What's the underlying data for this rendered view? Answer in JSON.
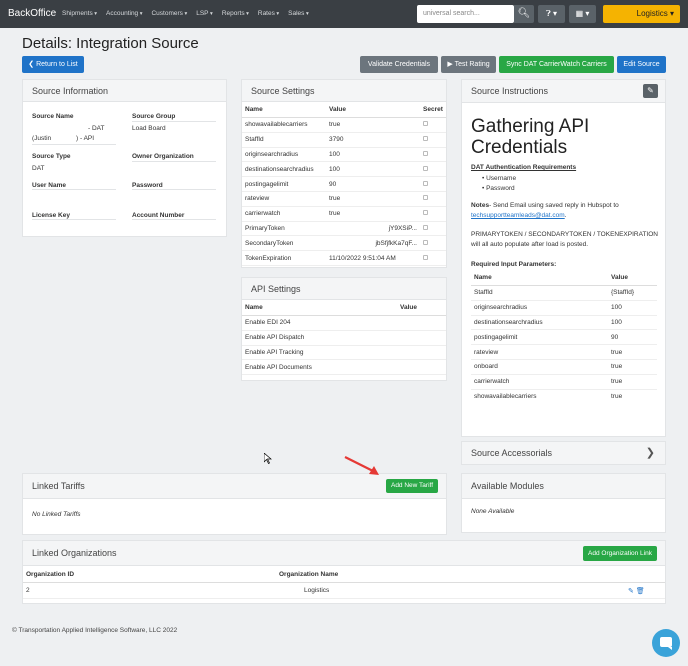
{
  "nav": {
    "brand": "BackOffice",
    "menu": [
      "Shipments",
      "Accounting",
      "Customers",
      "LSP",
      "Reports",
      "Rates",
      "Sales"
    ],
    "search_placeholder": "universal search...",
    "org": "Logistics"
  },
  "page": {
    "title": "Details: Integration Source",
    "return_label": "Return to List",
    "validate_label": "Validate Credentials",
    "test_label": "Test Rating",
    "sync_label": "Sync DAT CarrierWatch Carriers",
    "edit_label": "Edit Source"
  },
  "info": {
    "title": "Source Information",
    "source_name_label": "Source Name",
    "source_name_line1": "- DAT",
    "source_name_line2": "(Justin",
    "source_name_line3": ") - API",
    "source_group_label": "Source Group",
    "source_group": "Load Board",
    "source_type_label": "Source Type",
    "source_type": "DAT",
    "owner_label": "Owner Organization",
    "user_label": "User Name",
    "password_label": "Password",
    "license_label": "License Key",
    "account_label": "Account Number"
  },
  "settings": {
    "title": "Source Settings",
    "headers": [
      "Name",
      "Value",
      "Secret"
    ],
    "rows": [
      {
        "name": "showavailablecarriers",
        "value": "true"
      },
      {
        "name": "StaffId",
        "value": "3790"
      },
      {
        "name": "originsearchradius",
        "value": "100"
      },
      {
        "name": "destinationsearchradius",
        "value": "100"
      },
      {
        "name": "postingagelimit",
        "value": "90"
      },
      {
        "name": "rateview",
        "value": "true"
      },
      {
        "name": "carrierwatch",
        "value": "true"
      },
      {
        "name": "PrimaryToken",
        "value": "jY9XSiP..."
      },
      {
        "name": "SecondaryToken",
        "value": "jbSfjfkKa7qF..."
      },
      {
        "name": "TokenExpiration",
        "value": "11/10/2022 9:51:04 AM"
      }
    ]
  },
  "api": {
    "title": "API Settings",
    "headers": [
      "Name",
      "Value"
    ],
    "rows": [
      "Enable EDI 204",
      "Enable API Dispatch",
      "Enable API Tracking",
      "Enable API Documents"
    ]
  },
  "instructions": {
    "title": "Source Instructions",
    "heading": "Gathering API Credentials",
    "auth_title": "DAT Authentication Requirements",
    "bullets": [
      "Username",
      "Password"
    ],
    "notes_label": "Notes",
    "notes_text": "- Send Email using saved reply in Hubspot to",
    "email": "techsupportteamleads@dat.com",
    "email_suffix": ".",
    "tokens_text": "PRIMARYTOKEN / SECONDARYTOKEN / TOKENEXPIRATION will all auto populate after load is posted.",
    "req_title": "Required Input Parameters:",
    "headers": [
      "Name",
      "Value"
    ],
    "rows": [
      {
        "name": "StaffId",
        "value": "{StaffId}"
      },
      {
        "name": "originsearchradius",
        "value": "100"
      },
      {
        "name": "destinationsearchradius",
        "value": "100"
      },
      {
        "name": "postingagelimit",
        "value": "90"
      },
      {
        "name": "rateview",
        "value": "true"
      },
      {
        "name": "onboard",
        "value": "true"
      },
      {
        "name": "carrierwatch",
        "value": "true"
      },
      {
        "name": "showavailablecarriers",
        "value": "true"
      }
    ]
  },
  "accessorials": {
    "title": "Source Accessorials"
  },
  "modules": {
    "title": "Available Modules",
    "empty": "None Available"
  },
  "tariffs": {
    "title": "Linked Tariffs",
    "add_label": "Add New Tariff",
    "empty": "No Linked Tariffs"
  },
  "orgs": {
    "title": "Linked Organizations",
    "add_label": "Add Organization Link",
    "headers": [
      "Organization ID",
      "Organization Name"
    ],
    "rows": [
      {
        "id": "2",
        "name": "Logistics"
      }
    ]
  },
  "footer": "© Transportation Applied Intelligence Software, LLC 2022",
  "colors": {
    "primary": "#1f73c8",
    "success": "#28a745",
    "warning": "#f5b301",
    "navbar": "#3a3f44"
  }
}
